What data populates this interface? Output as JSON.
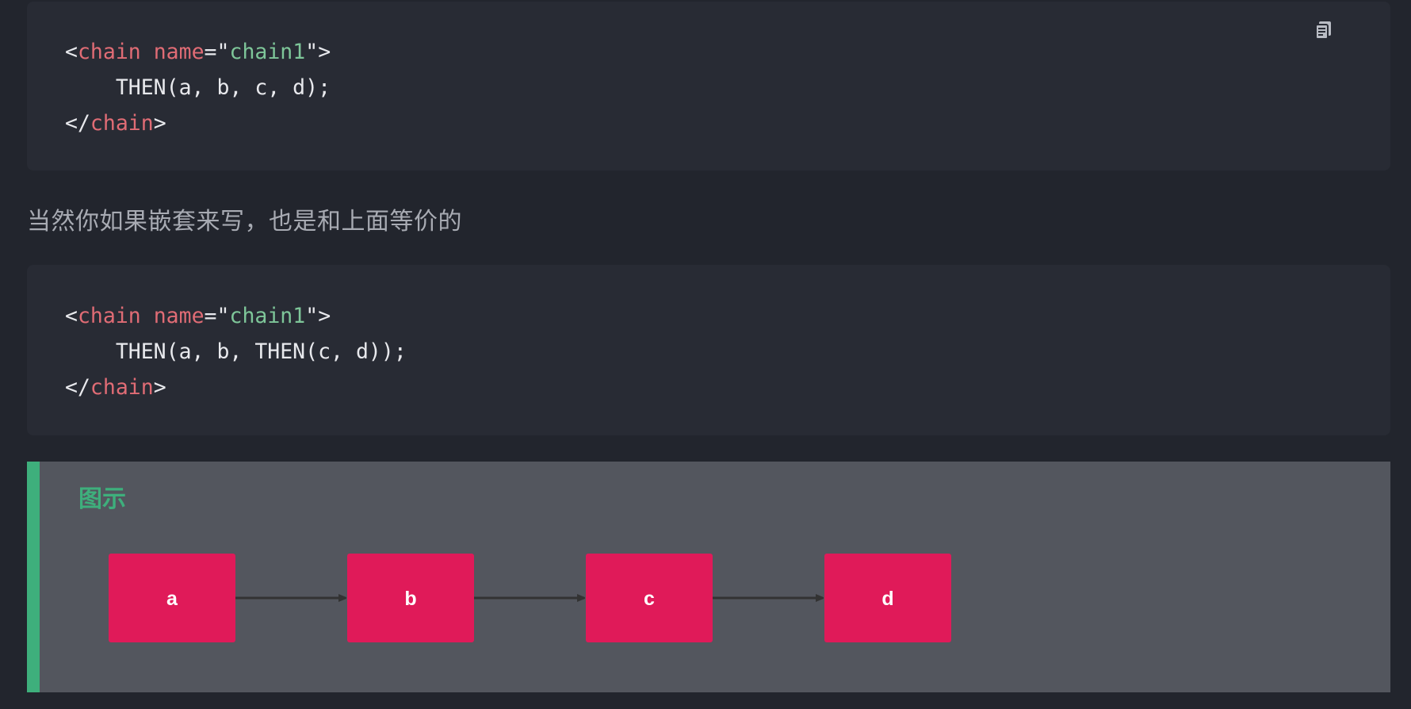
{
  "code_blocks": [
    {
      "lines": [
        [
          {
            "t": "<",
            "c": "punct"
          },
          {
            "t": "chain",
            "c": "tag"
          },
          {
            "t": " ",
            "c": "plain"
          },
          {
            "t": "name",
            "c": "attr"
          },
          {
            "t": "=",
            "c": "punct"
          },
          {
            "t": "\"",
            "c": "punct"
          },
          {
            "t": "chain1",
            "c": "str"
          },
          {
            "t": "\"",
            "c": "punct"
          },
          {
            "t": ">",
            "c": "punct"
          }
        ],
        [
          {
            "t": "    THEN(a, b, c, d);",
            "c": "plain"
          }
        ],
        [
          {
            "t": "</",
            "c": "punct"
          },
          {
            "t": "chain",
            "c": "tag"
          },
          {
            "t": ">",
            "c": "punct"
          }
        ]
      ],
      "copy_icon": "copy-icon"
    },
    {
      "lines": [
        [
          {
            "t": "<",
            "c": "punct"
          },
          {
            "t": "chain",
            "c": "tag"
          },
          {
            "t": " ",
            "c": "plain"
          },
          {
            "t": "name",
            "c": "attr"
          },
          {
            "t": "=",
            "c": "punct"
          },
          {
            "t": "\"",
            "c": "punct"
          },
          {
            "t": "chain1",
            "c": "str"
          },
          {
            "t": "\"",
            "c": "punct"
          },
          {
            "t": ">",
            "c": "punct"
          }
        ],
        [
          {
            "t": "    THEN(a, b, THEN(c, d));",
            "c": "plain"
          }
        ],
        [
          {
            "t": "</",
            "c": "punct"
          },
          {
            "t": "chain",
            "c": "tag"
          },
          {
            "t": ">",
            "c": "punct"
          }
        ]
      ]
    }
  ],
  "paragraph": "当然你如果嵌套来写，也是和上面等价的",
  "diagram": {
    "title": "图示",
    "nodes": [
      "a",
      "b",
      "c",
      "d"
    ],
    "colors": {
      "node_fill": "#e01a59",
      "arrow": "#333333",
      "accent": "#3eaf7c"
    }
  }
}
